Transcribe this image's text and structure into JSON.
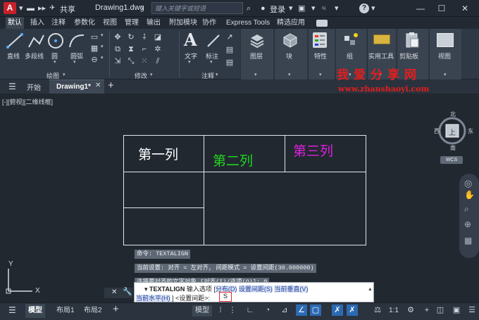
{
  "titlebar": {
    "app_logo": "A",
    "share": "共享",
    "doc_title": "Drawing1.dwg",
    "search_placeholder": "键入关键字或短语",
    "login": "登录",
    "help": "?"
  },
  "menu": {
    "tabs": [
      "默认",
      "插入",
      "注释",
      "参数化",
      "视图",
      "管理",
      "输出",
      "附加模块",
      "协作",
      "Express Tools",
      "精选应用"
    ]
  },
  "ribbon": {
    "draw_tools": [
      "直线",
      "多段线",
      "圆",
      "圆弧"
    ],
    "draw_panel": "绘图",
    "modify_panel": "修改",
    "text_tool": "文字",
    "dim_tool": "标注",
    "annotation_panel": "注释",
    "layers": "图层",
    "block": "块",
    "properties": "特性",
    "group": "组",
    "utilities": "实用工具",
    "clipboard": "剪贴板",
    "view": "视图"
  },
  "filetabs": {
    "start": "开始",
    "doc": "Drawing1*"
  },
  "canvas": {
    "viewport_label": "[-][俯视][二维线框]",
    "cells": [
      "第一列",
      "第二列",
      "第三列"
    ],
    "cell_colors": [
      "#ffffff",
      "#22d322",
      "#e01fe0"
    ]
  },
  "watermark": {
    "cn": "我爱分享网",
    "url": "www.zhanshaoyi.com"
  },
  "viewcube": {
    "north": "北",
    "west": "西",
    "east": "东",
    "south": "南",
    "face": "上",
    "wcs": "WCS"
  },
  "ucs": {
    "y": "Y",
    "x": "X"
  },
  "command": {
    "history": [
      "命令: TEXTALIGN",
      "当前设置: 对齐 = 左对齐, 间距模式 = 设置间距(30.000000)",
      "选择要对齐的文字对象 [对齐(I)/选项(O)]: 0"
    ],
    "prompt_name": "TEXTALIGN",
    "prompt_text": "输入选项 [",
    "options": [
      "分布(D)",
      "设置间距(S)",
      "当前垂直(V)"
    ],
    "line2_option": "当前水平(H)",
    "line2_tail": "] <设置间距>:",
    "input_value": "S"
  },
  "statusbar": {
    "model_tab": "模型",
    "layout1": "布局1",
    "layout2": "布局2",
    "model_btn": "模型",
    "scale": "1:1"
  }
}
